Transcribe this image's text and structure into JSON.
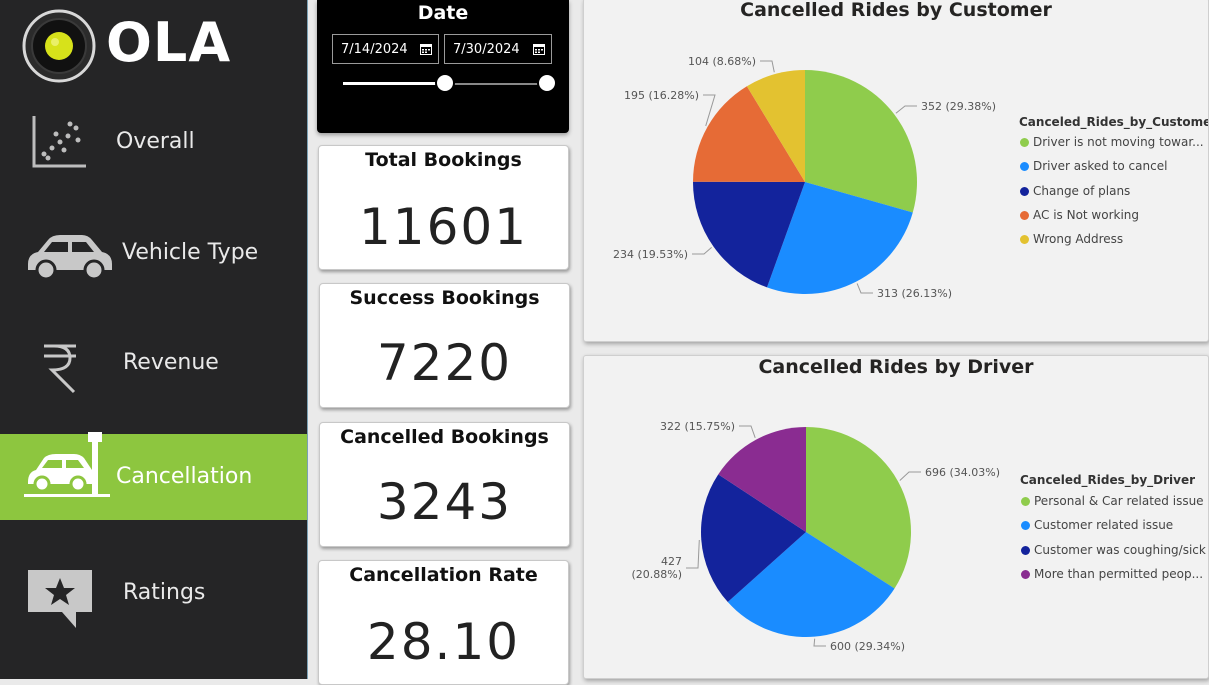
{
  "brand": {
    "name": "OLA"
  },
  "nav": {
    "items": [
      {
        "label": "Overall",
        "icon": "scatter-chart-icon",
        "active": false
      },
      {
        "label": "Vehicle Type",
        "icon": "car-icon",
        "active": false
      },
      {
        "label": "Revenue",
        "icon": "rupee-icon",
        "active": false
      },
      {
        "label": "Cancellation",
        "icon": "car-crash-icon",
        "active": true
      },
      {
        "label": "Ratings",
        "icon": "star-review-icon",
        "active": false
      }
    ]
  },
  "date_filter": {
    "title": "Date",
    "start": "7/14/2024",
    "end": "7/30/2024",
    "slider_start": 0.5,
    "slider_end": 1.0
  },
  "kpis": [
    {
      "title": "Total Bookings",
      "value": "11601"
    },
    {
      "title": "Success Bookings",
      "value": "7220"
    },
    {
      "title": "Cancelled Bookings",
      "value": "3243"
    },
    {
      "title": "Cancellation Rate",
      "value": "28.10"
    }
  ],
  "colors": {
    "accent": "#8dc63f",
    "green": "#8fcc4c",
    "blue": "#1a8cff",
    "navy": "#13239c",
    "orange": "#e66b36",
    "yellow": "#e3c230",
    "purple": "#8a2c91"
  },
  "chart_data": [
    {
      "type": "pie",
      "title": "Cancelled Rides by Customer",
      "legend_title": "Canceled_Rides_by_Customer",
      "legend_position": "right",
      "categories": [
        "Driver is not moving towar...",
        "Driver asked to cancel",
        "Change of plans",
        "AC is Not working",
        "Wrong Address"
      ],
      "values": [
        352,
        313,
        234,
        195,
        104
      ],
      "data_labels": [
        "352 (29.38%)",
        "313 (26.13%)",
        "234 (19.53%)",
        "195 (16.28%)",
        "104 (8.68%)"
      ],
      "colors": [
        "#8fcc4c",
        "#1a8cff",
        "#13239c",
        "#e66b36",
        "#e3c230"
      ]
    },
    {
      "type": "pie",
      "title": "Cancelled Rides by Driver",
      "legend_title": "Canceled_Rides_by_Driver",
      "legend_position": "right",
      "categories": [
        "Personal & Car related issue",
        "Customer related issue",
        "Customer was coughing/sick",
        "More than permitted peop..."
      ],
      "values": [
        696,
        600,
        427,
        322
      ],
      "data_labels": [
        "696 (34.03%)",
        "600 (29.34%)",
        "427 (20.88%)",
        "322 (15.75%)"
      ],
      "colors": [
        "#8fcc4c",
        "#1a8cff",
        "#13239c",
        "#8a2c91"
      ]
    }
  ]
}
